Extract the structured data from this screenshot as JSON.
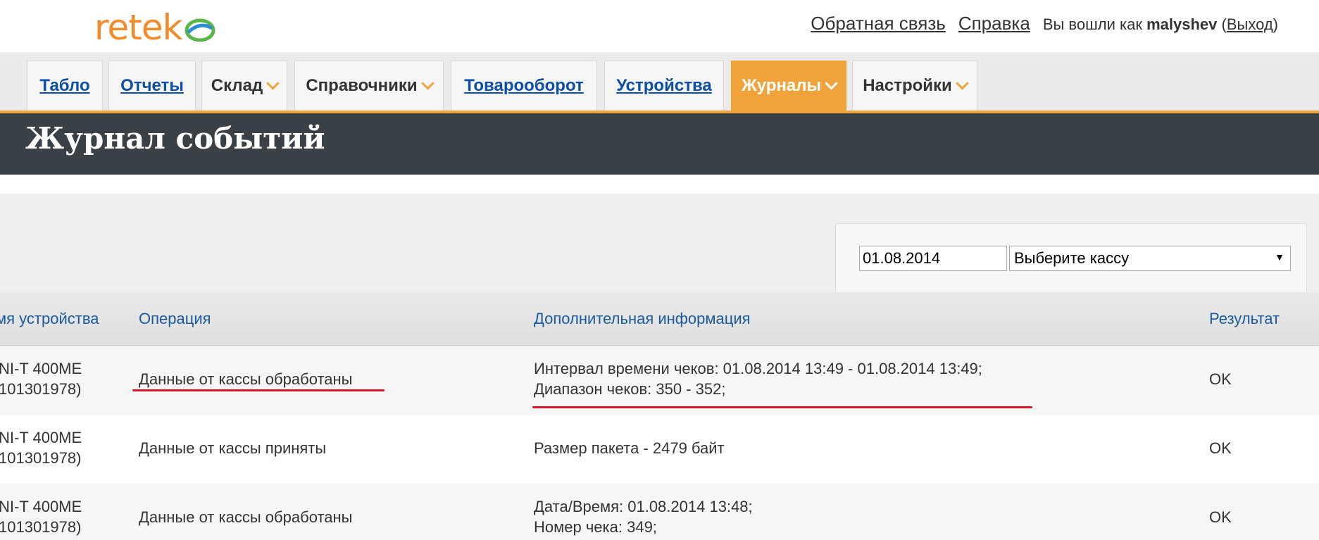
{
  "header": {
    "logo_text": "retek",
    "feedback_link": "Обратная связь",
    "help_link": "Справка",
    "logged_in_prefix": "Вы вошли как",
    "username": "malyshev",
    "logout_link": "Выход"
  },
  "nav": {
    "tabs": [
      {
        "label": "Табло",
        "link": true,
        "dropdown": false,
        "active": false
      },
      {
        "label": "Отчеты",
        "link": true,
        "dropdown": false,
        "active": false
      },
      {
        "label": "Склад",
        "link": false,
        "dropdown": true,
        "active": false
      },
      {
        "label": "Справочники",
        "link": false,
        "dropdown": true,
        "active": false
      },
      {
        "label": "Товарооборот",
        "link": true,
        "dropdown": false,
        "active": false
      },
      {
        "label": "Устройства",
        "link": true,
        "dropdown": false,
        "active": false
      },
      {
        "label": "Журналы",
        "link": false,
        "dropdown": true,
        "active": true
      },
      {
        "label": "Настройки",
        "link": false,
        "dropdown": true,
        "active": false
      }
    ]
  },
  "page": {
    "title": "Журнал событий"
  },
  "filters": {
    "date_value": "01.08.2014",
    "register_select": "Выберите кассу"
  },
  "table": {
    "columns": [
      "мя устройства",
      "Операция",
      "Дополнительная информация",
      "Результат"
    ],
    "rows": [
      {
        "device": [
          "NI-T 400ME",
          "101301978)"
        ],
        "operation": "Данные от кассы обработаны",
        "info": [
          "Интервал времени чеков: 01.08.2014 13:49 - 01.08.2014 13:49;",
          "Диапазон чеков: 350 - 352;"
        ],
        "result": "OK"
      },
      {
        "device": [
          "NI-T 400ME",
          "101301978)"
        ],
        "operation": "Данные от кассы приняты",
        "info": [
          "Размер пакета - 2479 байт"
        ],
        "result": "OK"
      },
      {
        "device": [
          "NI-T 400ME",
          "101301978)"
        ],
        "operation": "Данные от кассы обработаны",
        "info": [
          "Дата/Время: 01.08.2014 13:48;",
          "Номер чека: 349;"
        ],
        "result": "OK"
      }
    ]
  },
  "colors": {
    "accent": "#f0a33a",
    "title_bar": "#3a4146",
    "link": "#0b4fa8",
    "header_text": "#1a5a9b",
    "annotation": "#d51a24"
  }
}
